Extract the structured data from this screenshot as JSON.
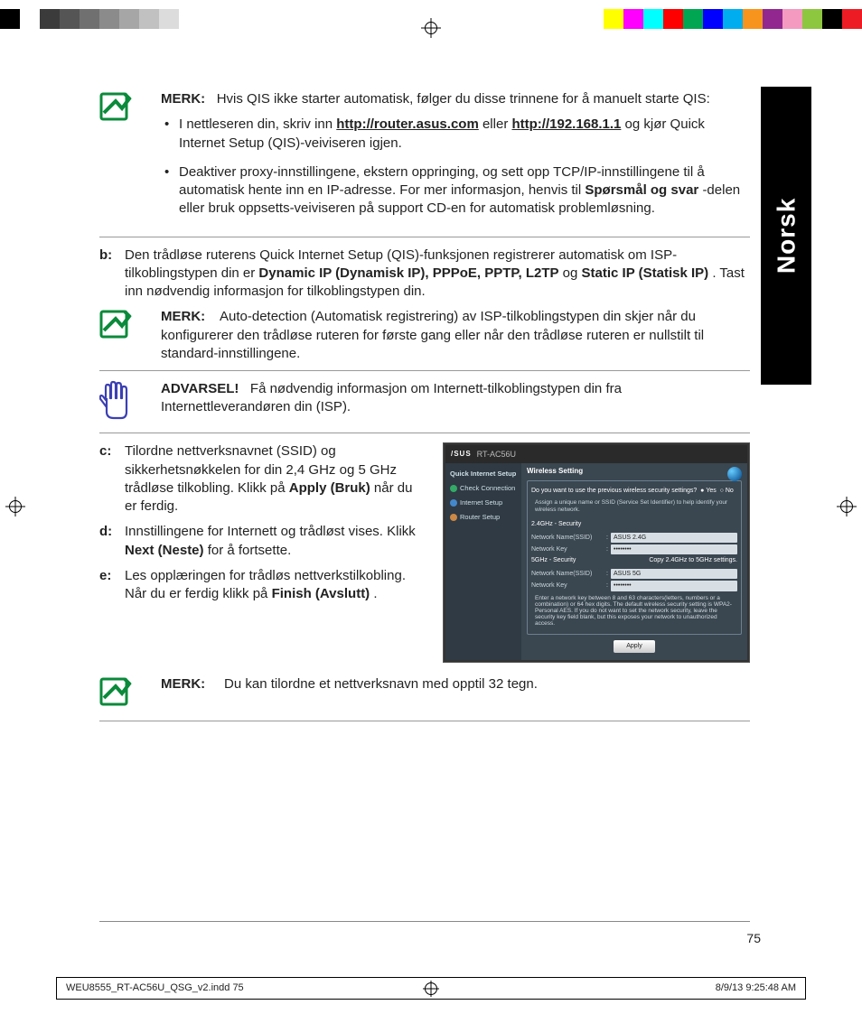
{
  "meta": {
    "language_tab": "Norsk",
    "page_number": "75",
    "slug_left": "WEU8555_RT-AC56U_QSG_v2.indd   75",
    "slug_right": "8/9/13   9:25:48 AM"
  },
  "labels": {
    "merk": "MERK:",
    "advarsel": "ADVARSEL!"
  },
  "note1": {
    "lead": "Hvis QIS ikke starter automatisk, følger du disse trinnene for å manuelt starte QIS:",
    "bullet1_pre": "I nettleseren din, skriv inn ",
    "bullet1_link1": "http://router.asus.com",
    "bullet1_mid": " eller ",
    "bullet1_link2": "http://192.168.1.1",
    "bullet1_post": " og kjør Quick Internet Setup (QIS)-veiviseren igjen.",
    "bullet2_pre": "Deaktiver proxy-innstillingene, ekstern oppringing, og sett opp TCP/IP-innstillingene til å automatisk hente inn en IP-adresse. For mer informasjon, henvis til ",
    "bullet2_bold": "Spørsmål og svar",
    "bullet2_post": "-delen eller bruk oppsetts-veiviseren på support CD-en for automatisk problemløsning."
  },
  "step_b": {
    "label": "b:",
    "pre": "Den trådløse ruterens Quick Internet Setup (QIS)-funksjonen registrerer automatisk om ISP-tilkoblingstypen din er ",
    "bold1": "Dynamic IP (Dynamisk IP), PPPoE, PPTP, L2TP",
    "mid": " og ",
    "bold2": "Static IP (Statisk IP)",
    "post": ". Tast inn nødvendig informasjon for tilkoblingstypen din."
  },
  "note2": {
    "body": "Auto-detection (Automatisk registrering) av ISP-tilkoblingstypen din skjer når du konfigurerer den trådløse ruteren for første gang eller når den trådløse ruteren er nullstilt til standard-innstillingene."
  },
  "warn": {
    "body": "Få nødvendig informasjon om Internett-tilkoblingstypen din fra Internettleverandøren din (ISP)."
  },
  "step_c": {
    "label": "c:",
    "pre": "Tilordne nettverksnavnet (SSID) og sikkerhetsnøkkelen for din 2,4 GHz og 5 GHz trådløse tilkobling. Klikk på ",
    "bold": "Apply (Bruk)",
    "post": " når du er ferdig."
  },
  "step_d": {
    "label": "d:",
    "pre": "Innstillingene for Internett og trådløst vises. Klikk ",
    "bold": "Next (Neste)",
    "post": " for å fortsette."
  },
  "step_e": {
    "label": "e:",
    "pre": "Les opplæringen for trådløs nettverkstilkobling. Når du er ferdig klikk på ",
    "bold": "Finish (Avslutt)",
    "post": "."
  },
  "note3": {
    "body": "Du kan tilordne et nettverksnavn med opptil 32 tegn."
  },
  "printbar": {
    "left": [
      "#000000",
      "#ffffff",
      "#3b3b3b",
      "#555555",
      "#707070",
      "#8b8b8b",
      "#a6a6a6",
      "#c1c1c1",
      "#dcdcdc",
      "#ffffff"
    ],
    "right": [
      "#ffff00",
      "#ff00ff",
      "#00ffff",
      "#ff0000",
      "#00a651",
      "#0000ff",
      "#00aeef",
      "#f7941d",
      "#92278f",
      "#f49ac1",
      "#8dc63f",
      "#000000",
      "#ed1c24"
    ]
  },
  "router_ui": {
    "logo": "/SUS",
    "model": "RT-AC56U",
    "sidebar": {
      "head": "Quick Internet Setup",
      "items": [
        "Check Connection",
        "Internet Setup",
        "Router Setup"
      ]
    },
    "title": "Wireless Setting",
    "question": "Do you want to use the previous wireless security settings?",
    "opt_yes": "Yes",
    "opt_no": "No",
    "desc": "Assign a unique name or SSID (Service Set Identifier) to help identify your wireless network.",
    "sec24": "2.4GHz - Security",
    "sec5": "5GHz - Security",
    "lab_ssid": "Network Name(SSID)",
    "lab_key": "Network Key",
    "val_ssid24": "ASUS 2.4G",
    "val_key": "••••••••",
    "copy": "Copy 2.4GHz to 5GHz settings.",
    "val_ssid5": "ASUS 5G",
    "note": "Enter a network key between 8 and 63 characters(letters, numbers or a combination) or 64 hex digits. The default wireless security setting is WPA2-Personal AES. If you do not want to set the network security, leave the security key field blank, but this exposes your network to unauthorized access.",
    "apply": "Apply"
  }
}
